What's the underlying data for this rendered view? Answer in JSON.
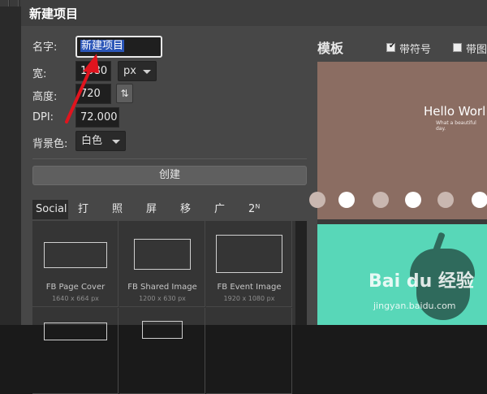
{
  "dialog": {
    "title": "新建项目",
    "form": {
      "name_label": "名字:",
      "name_value": "新建项目",
      "width_label": "宽:",
      "width_value": "1080",
      "width_unit": "px",
      "height_label": "高度:",
      "height_value": "720",
      "swap_icon": "swap-arrows-icon",
      "dpi_label": "DPI:",
      "dpi_value": "72.000",
      "bg_label": "背景色:",
      "bg_value": "白色"
    },
    "create_label": "创建",
    "tabs": [
      {
        "label": "Social",
        "active": true
      },
      {
        "label": "打印"
      },
      {
        "label": "照片"
      },
      {
        "label": "屏幕"
      },
      {
        "label": "移动"
      },
      {
        "label": "广告"
      },
      {
        "label": "2ᴺ"
      }
    ],
    "presets": [
      {
        "name": "FB Page Cover",
        "size": "1640 x 664 px"
      },
      {
        "name": "FB Shared Image",
        "size": "1200 x 630 px"
      },
      {
        "name": "FB Event Image",
        "size": "1920 x 1080 px"
      }
    ],
    "templates": {
      "title": "模板",
      "check1_label": "带符号",
      "check1_checked": true,
      "check2_label": "带图",
      "check2_checked": false,
      "hello_text": "Hello Worl",
      "hello_sub": "What a beautiful day."
    }
  },
  "watermark": {
    "logo": "Bai du 经验",
    "url": "jingyan.baidu.com"
  },
  "colors": {
    "annotation_arrow": "#e0141e",
    "selection": "#2b56b8",
    "template_brown": "#8b6d62",
    "template_teal": "#58d7b8"
  }
}
